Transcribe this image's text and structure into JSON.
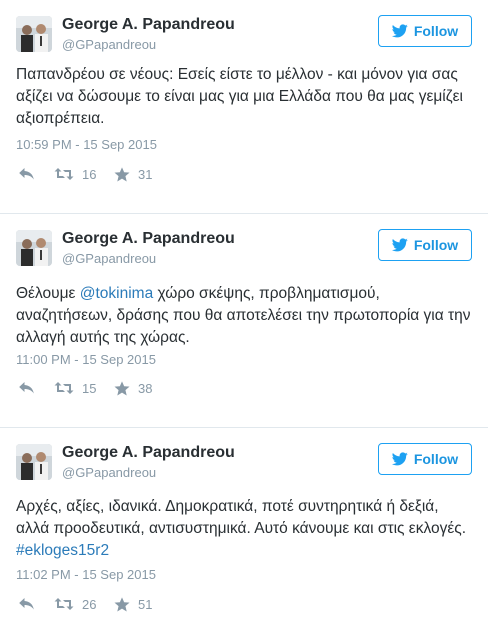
{
  "tweets": [
    {
      "author_name": "George A. Papandreou",
      "author_handle": "@GPapandreou",
      "follow_label": "Follow",
      "text_parts": [
        {
          "text": "Παπανδρέου σε νέους: Εσείς είστε το μέλλον - και μόνον για σας αξίζει να δώσουμε το είναι μας για μια Ελλάδα που θα μας γεμίζει αξιοπρέπεια.",
          "link": false
        }
      ],
      "timestamp": "10:59 PM - 15 Sep 2015",
      "retweets": "16",
      "likes": "31"
    },
    {
      "author_name": "George A. Papandreou",
      "author_handle": "@GPapandreou",
      "follow_label": "Follow",
      "text_parts": [
        {
          "text": "Θέλουμε ",
          "link": false
        },
        {
          "text": "@tokinima",
          "link": true
        },
        {
          "text": " χώρο σκέψης, προβληματισμού, αναζητήσεων, δράσης που θα αποτελέσει την πρωτοπορία για την αλλαγή αυτής της χώρας.",
          "link": false
        }
      ],
      "timestamp": "11:00 PM - 15 Sep 2015",
      "retweets": "15",
      "likes": "38"
    },
    {
      "author_name": "George A. Papandreou",
      "author_handle": "@GPapandreou",
      "follow_label": "Follow",
      "text_parts": [
        {
          "text": "Αρχές, αξίες, ιδανικά. Δημοκρατικά, ποτέ συντηρητικά ή δεξιά, αλλά προοδευτικά, αντισυστημικά. Αυτό κάνουμε και στις εκλογές. ",
          "link": false
        },
        {
          "text": "#ekloges15r2",
          "link": true
        }
      ],
      "timestamp": "11:02 PM - 15 Sep 2015",
      "retweets": "26",
      "likes": "51"
    }
  ],
  "icons": {
    "bird": "twitter-bird-icon",
    "reply": "reply-icon",
    "retweet": "retweet-icon",
    "like": "star-icon"
  },
  "colors": {
    "accent": "#1da1f2",
    "link": "#2b7bb9",
    "text": "#292f33",
    "muted": "#8899a6",
    "divider": "#e1e8ed"
  }
}
